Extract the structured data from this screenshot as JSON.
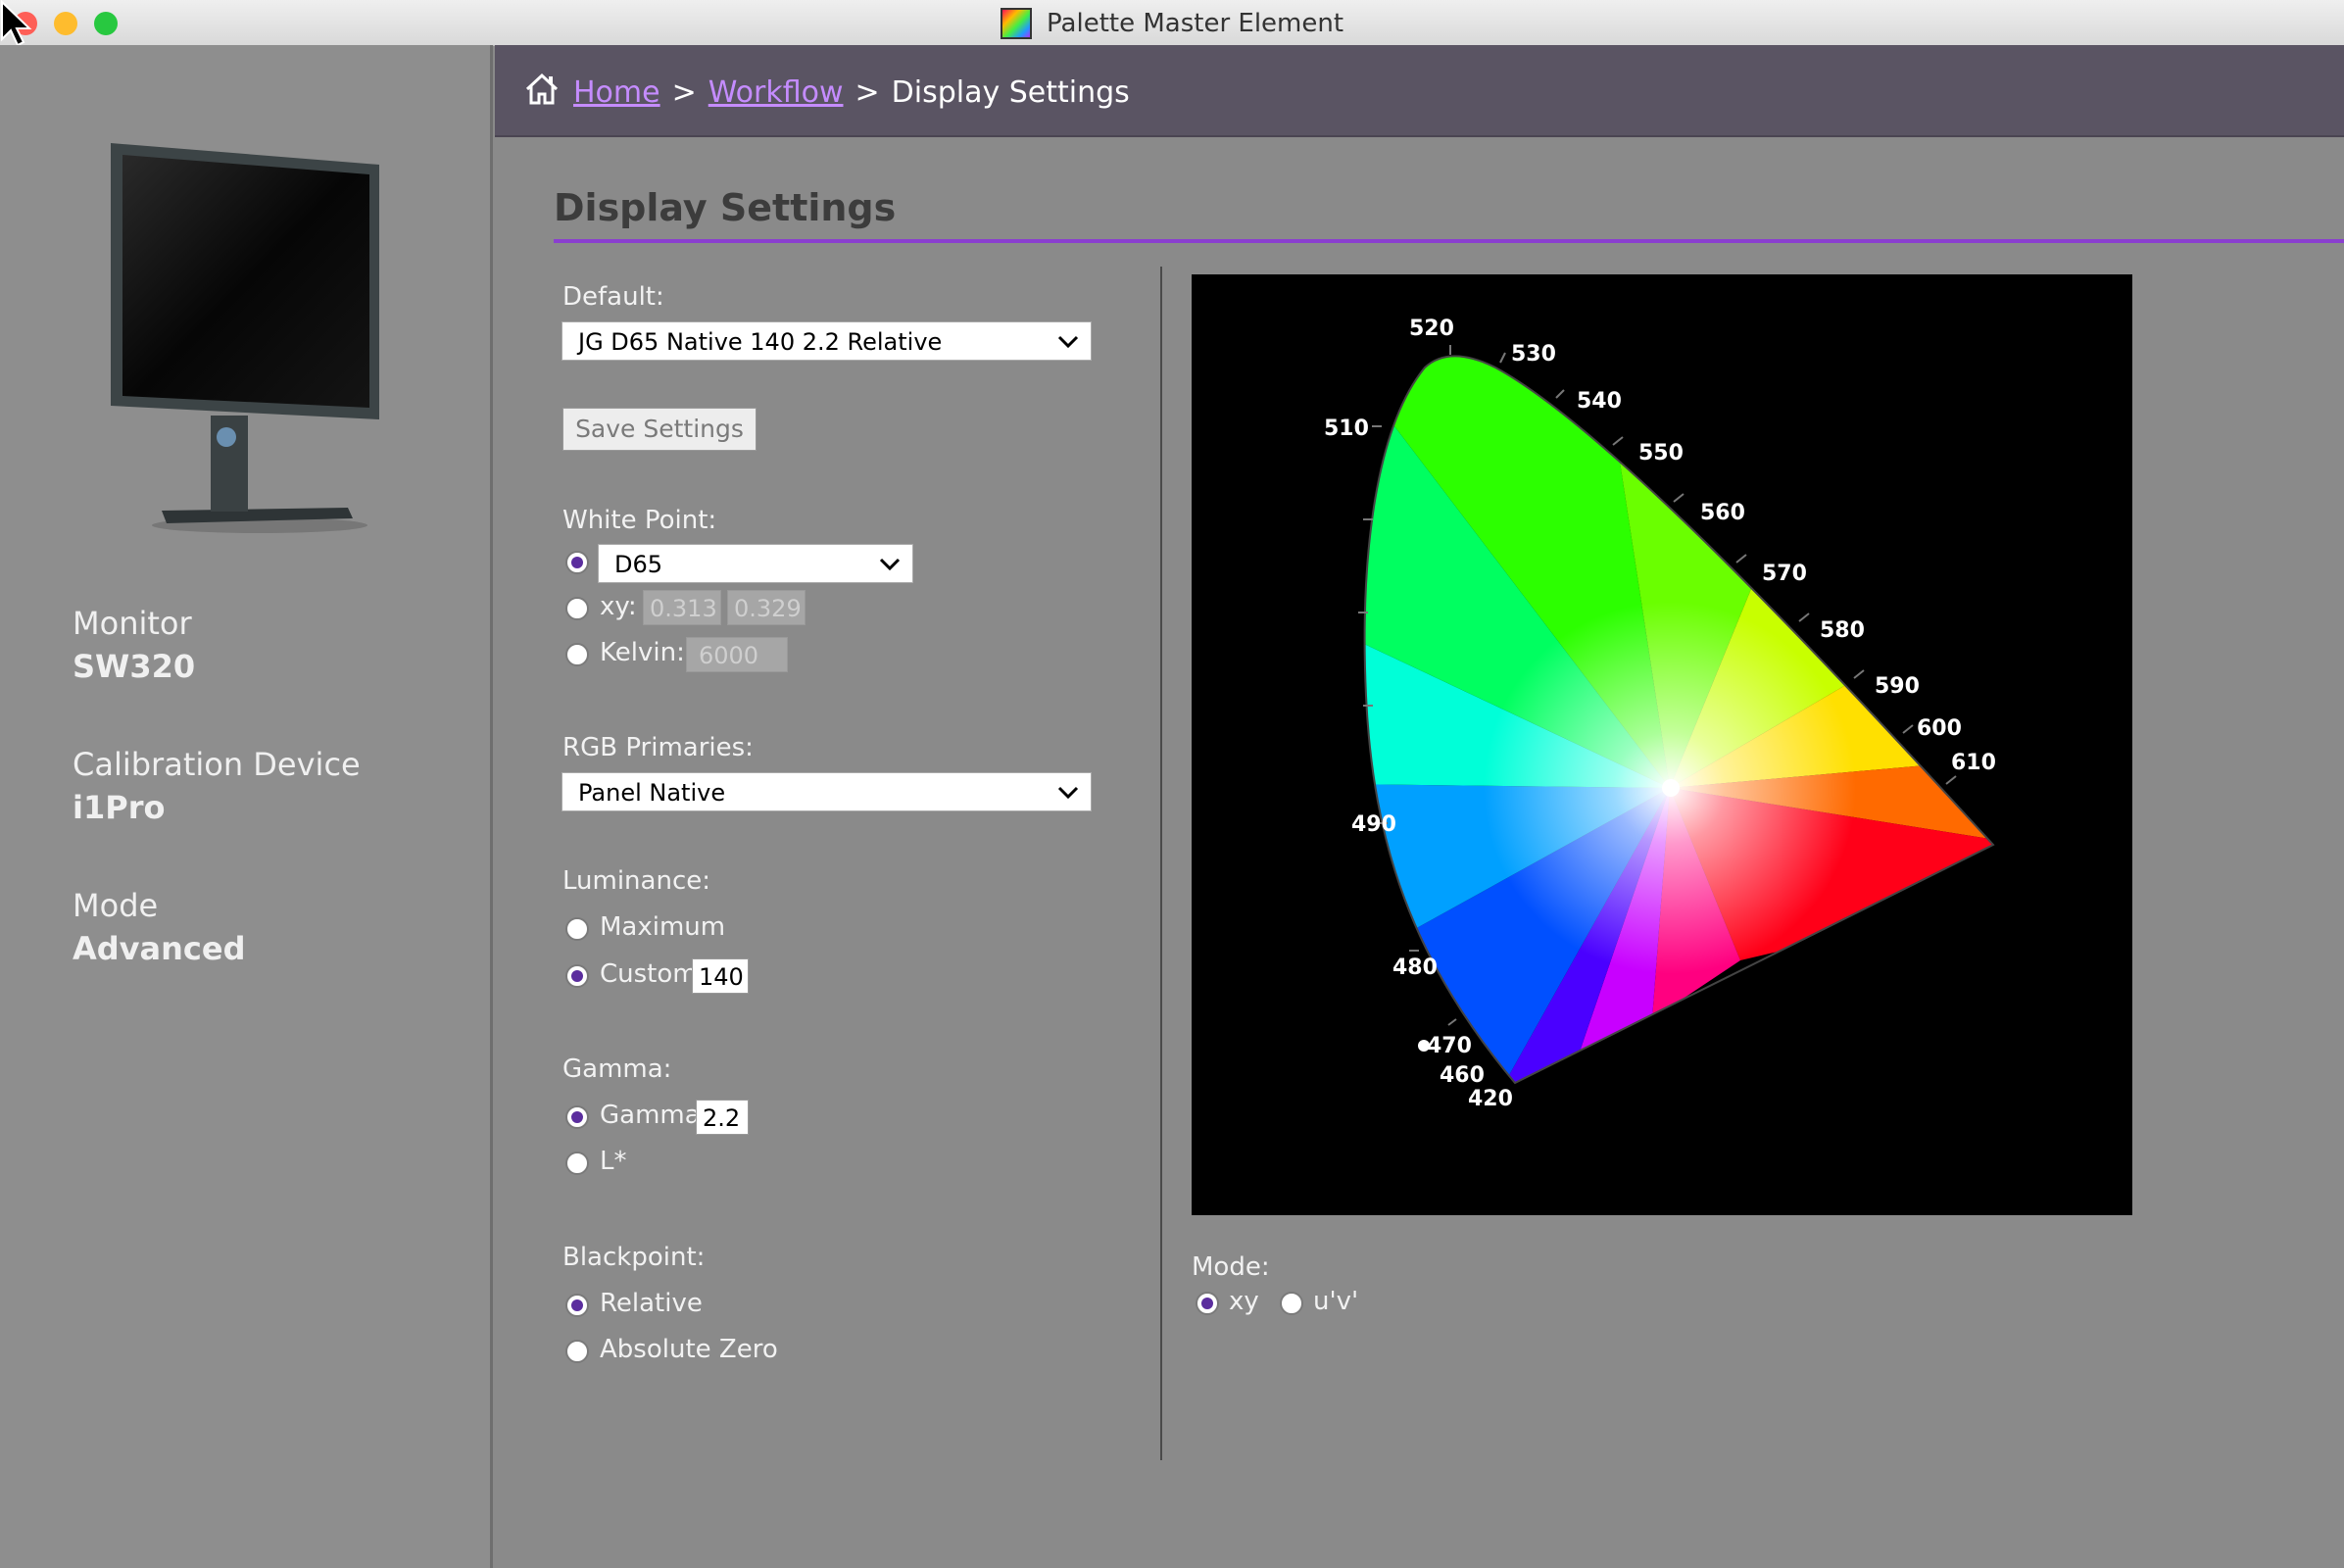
{
  "window": {
    "title": "Palette Master Element"
  },
  "sidebar": {
    "monitor_label": "Monitor",
    "monitor_value": "SW320",
    "device_label": "Calibration Device",
    "device_value": "i1Pro",
    "mode_label": "Mode",
    "mode_value": "Advanced"
  },
  "breadcrumb": {
    "home": "Home",
    "workflow": "Workflow",
    "sep": ">",
    "current": "Display Settings"
  },
  "page": {
    "title": "Display Settings"
  },
  "default": {
    "label": "Default:",
    "selected": "JG D65 Native 140 2.2 Relative",
    "save_button": "Save Settings"
  },
  "white_point": {
    "label": "White Point:",
    "preset_selected": "D65",
    "preset_checked": true,
    "xy_label": "xy:",
    "x_value": "0.313",
    "y_value": "0.329",
    "kelvin_label": "Kelvin:",
    "kelvin_value": "6000"
  },
  "rgb_primaries": {
    "label": "RGB Primaries:",
    "selected": "Panel Native"
  },
  "luminance": {
    "label": "Luminance:",
    "maximum_label": "Maximum",
    "custom_label": "Custom",
    "custom_value": "140",
    "selected": "Custom"
  },
  "gamma": {
    "label": "Gamma:",
    "gamma_label": "Gamma",
    "gamma_value": "2.2",
    "lstar_label": "L*",
    "selected": "Gamma"
  },
  "blackpoint": {
    "label": "Blackpoint:",
    "relative_label": "Relative",
    "absolute_label": "Absolute Zero",
    "selected": "Relative"
  },
  "cie_diagram": {
    "wavelength_labels": [
      "520",
      "530",
      "540",
      "550",
      "560",
      "570",
      "580",
      "590",
      "600",
      "610",
      "510",
      "490",
      "480",
      "470",
      "460",
      "420"
    ]
  },
  "mode": {
    "label": "Mode:",
    "xy_label": "xy",
    "uv_label": "u'v'",
    "selected": "xy"
  },
  "colors": {
    "accent": "#8a3fcf",
    "breadcrumb_bg": "#5a5463",
    "link": "#c58cff",
    "radio_dot": "#5b2d9e"
  }
}
